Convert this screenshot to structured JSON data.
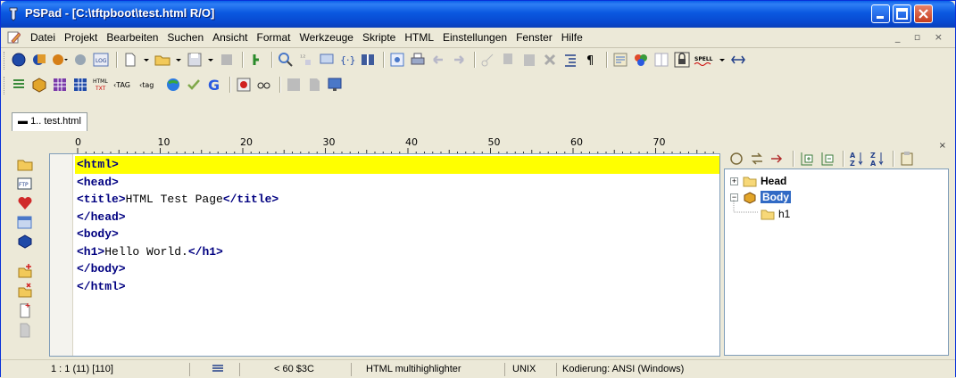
{
  "window": {
    "title": "PSPad - [C:\\tftpboot\\test.html R/O]"
  },
  "menu": {
    "items": [
      "Datei",
      "Projekt",
      "Bearbeiten",
      "Suchen",
      "Ansicht",
      "Format",
      "Werkzeuge",
      "Skripte",
      "HTML",
      "Einstellungen",
      "Fenster",
      "Hilfe"
    ],
    "mdi_controls": "_ ▫ ×"
  },
  "toolbar": {
    "log_label": "LOG",
    "spell_label": "SPELL",
    "html_label": "HTML",
    "txt_label": "TXT",
    "tag_label_1": "‹TAG",
    "tag_label_2": "‹tag"
  },
  "tabs": [
    {
      "label": "1.. test.html",
      "active": true
    }
  ],
  "ruler": {
    "labels": [
      "0",
      "10",
      "20",
      "30",
      "40",
      "50",
      "60",
      "70"
    ]
  },
  "editor": {
    "lines": [
      {
        "open": "<html>",
        "text": "",
        "close": ""
      },
      {
        "open": "<head>",
        "text": "",
        "close": ""
      },
      {
        "open": "<title>",
        "text": "HTML Test Page",
        "close": "</title>"
      },
      {
        "open": "</head>",
        "text": "",
        "close": ""
      },
      {
        "open": "<body>",
        "text": "",
        "close": ""
      },
      {
        "open": "<h1>",
        "text": "Hello World.",
        "close": "</h1>"
      },
      {
        "open": "</body>",
        "text": "",
        "close": ""
      },
      {
        "open": "</html>",
        "text": "",
        "close": ""
      }
    ],
    "highlight_color": "#ffff00",
    "tag_color": "#000080"
  },
  "left_toolbar": {
    "ftp_label": "FTP"
  },
  "tree": {
    "close_glyph": "×",
    "nodes": [
      {
        "label": "Head",
        "expander": "+",
        "selected": false
      },
      {
        "label": "Body",
        "expander": "−",
        "selected": true
      },
      {
        "label": "h1",
        "expander": "",
        "selected": false
      }
    ]
  },
  "status": {
    "position": "1 : 1  (11)  [110]",
    "char_info": "<  60  $3C",
    "highlighter": "HTML multihighlighter",
    "line_endings": "UNIX",
    "encoding": "Kodierung: ANSI (Windows)"
  },
  "colors": {
    "titlebar": "#0a58e0",
    "selection": "#316ac5"
  }
}
